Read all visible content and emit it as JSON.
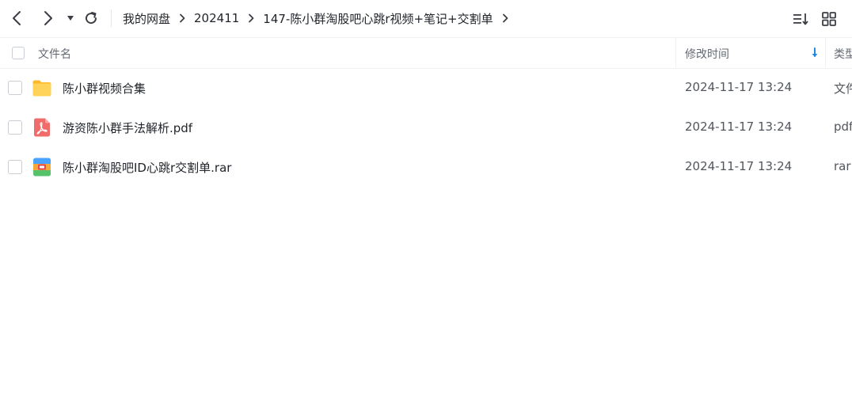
{
  "toolbar": {
    "back_icon": "chevron-left-icon",
    "forward_icon": "chevron-right-icon",
    "history_dropdown_icon": "caret-down-icon",
    "refresh_icon": "refresh-icon",
    "sort_icon": "sort-list-icon",
    "grid_icon": "grid-view-icon"
  },
  "breadcrumb": [
    {
      "label": "我的网盘"
    },
    {
      "label": "202411"
    },
    {
      "label": "147-陈小群淘股吧心跳r视频+笔记+交割单"
    }
  ],
  "table": {
    "columns": {
      "name": "文件名",
      "modified": "修改时间",
      "type": "类型"
    },
    "sort_direction": "descending",
    "rows": [
      {
        "name": "陈小群视频合集",
        "modified": "2024-11-17 13:24",
        "type": "文件",
        "icon": "folder-icon"
      },
      {
        "name": "游资陈小群手法解析.pdf",
        "modified": "2024-11-17 13:24",
        "type": "pdf",
        "icon": "pdf-file-icon"
      },
      {
        "name": "陈小群淘股吧ID心跳r交割单.rar",
        "modified": "2024-11-17 13:24",
        "type": "rar",
        "icon": "rar-archive-icon"
      }
    ]
  },
  "colors": {
    "accent": "#1e88e5",
    "folder": "#ffc53d",
    "pdf": "#f26b6b",
    "text": "#1f2329",
    "muted": "#646a73"
  }
}
